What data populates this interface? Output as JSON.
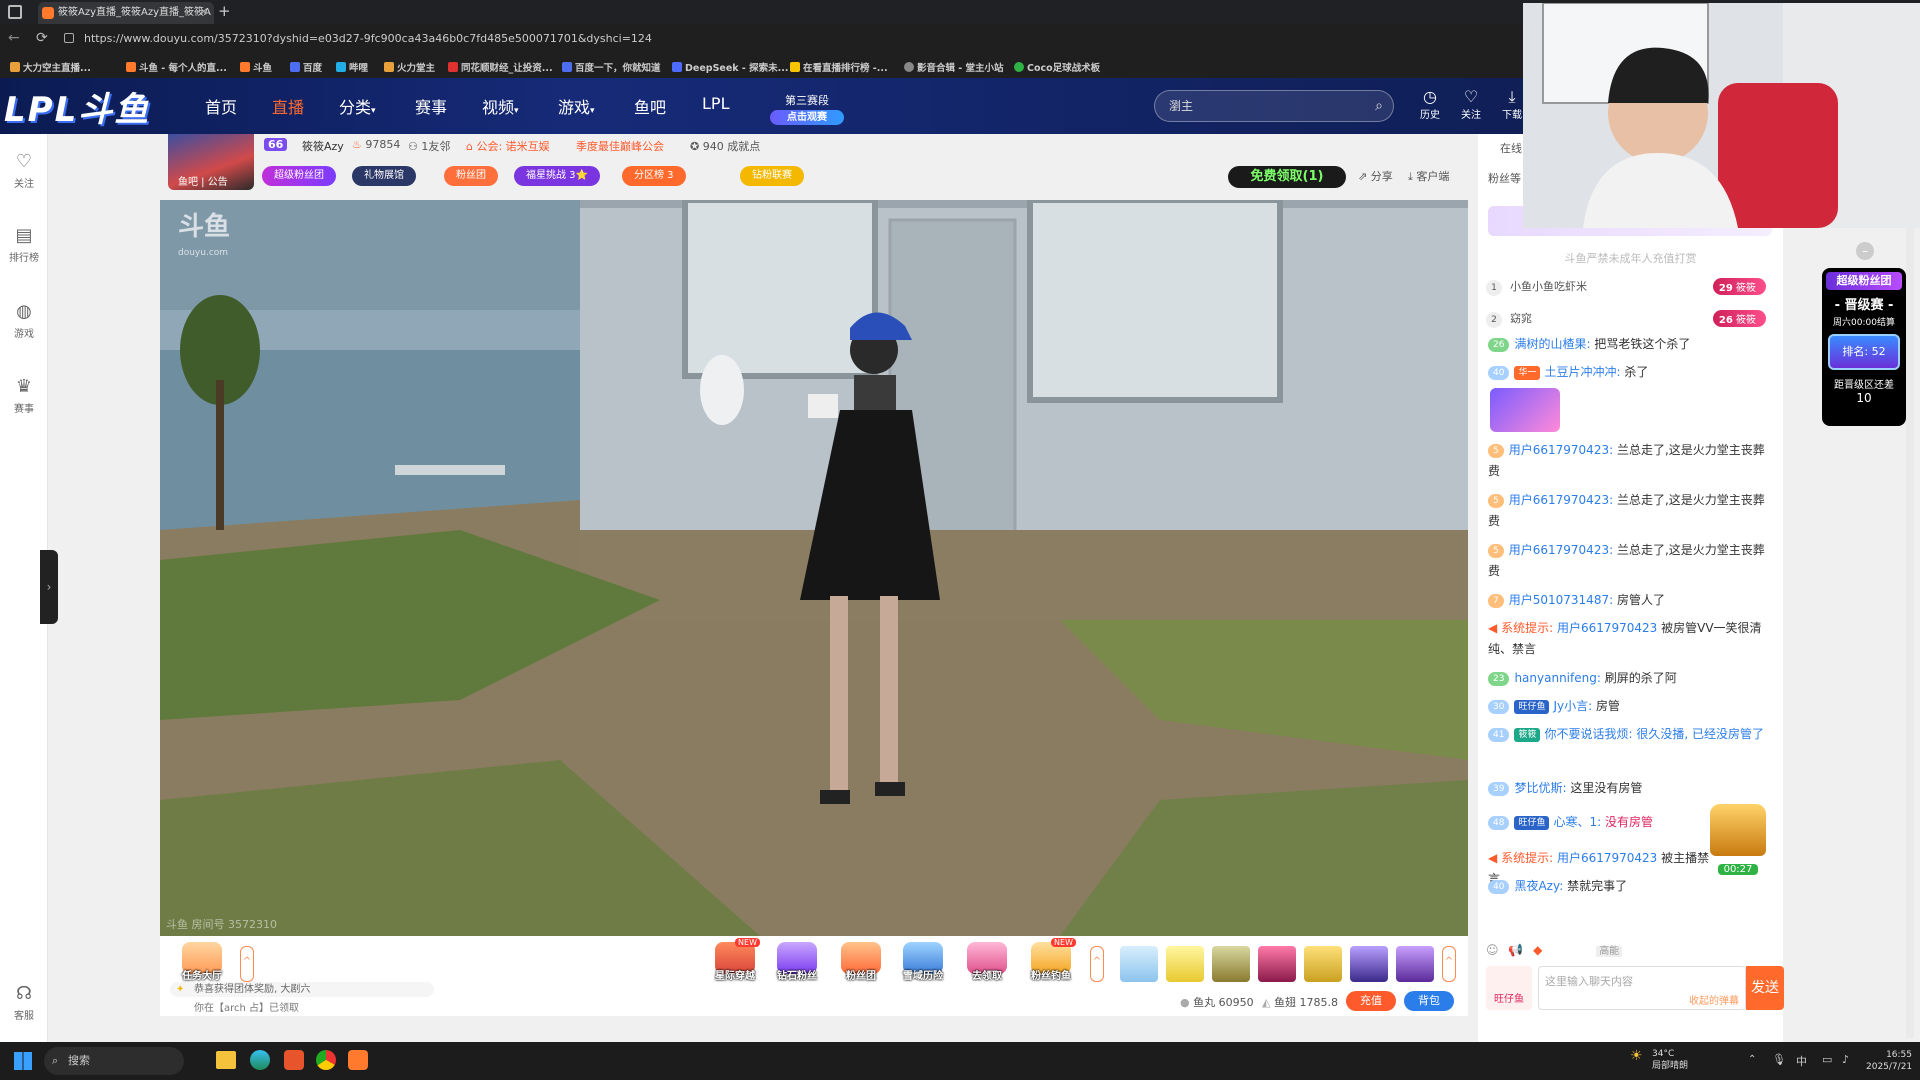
{
  "browser": {
    "tab_title": "筱筱Azy直播_筱筱Azy直播_筱筱A",
    "url": "https://www.douyu.com/3572310?dyshid=e03d27-9fc900ca43a46b0c7fd485e500071701&dyshci=124",
    "bookmarks": [
      "大力空主直播...",
      "斗鱼 - 每个人的直...",
      "斗鱼",
      "百度",
      "哔哩",
      "火力堂主",
      "同花顺财经_让投资...",
      "百度一下，你就知道",
      "DeepSeek - 探索未...",
      "在看直播排行榜 -...",
      "影音合辑 - 堂主小站",
      "Coco足球战术板"
    ]
  },
  "header": {
    "logo": "LPL斗鱼",
    "nav": [
      "首页",
      "直播",
      "分类",
      "赛事",
      "视频",
      "游戏",
      "鱼吧",
      "LPL"
    ],
    "season_line1": "第三赛段",
    "season_line2": "点击观赛",
    "search_placeholder": "瀏主",
    "icons": [
      {
        "label": "历史",
        "icon": "clock-icon"
      },
      {
        "label": "关注",
        "icon": "heart-icon"
      },
      {
        "label": "下载",
        "icon": "download-icon"
      }
    ]
  },
  "sidebar": {
    "items": [
      {
        "label": "关注",
        "icon": "heart-icon"
      },
      {
        "label": "排行榜",
        "icon": "ranking-icon"
      },
      {
        "label": "游戏",
        "icon": "game-icon"
      },
      {
        "label": "赛事",
        "icon": "trophy-icon"
      },
      {
        "label": "客服",
        "icon": "headset-icon"
      }
    ]
  },
  "streamer": {
    "avatar_tags": "鱼吧 | 公告",
    "level": "66",
    "name": "筱筱Azy",
    "hot": "97854",
    "friends": "1友邻",
    "guild": "公会: 诺米互娱",
    "guild_award": "季度最佳巅峰公会",
    "achievement": "940 成就点",
    "badges": [
      "超级粉丝团",
      "礼物展馆",
      "粉丝团",
      "福星挑战 3⭐",
      "分区榜 3",
      "钻粉联赛"
    ],
    "free_btn": "免费领取(1)",
    "share": "分享",
    "client": "客户端"
  },
  "video": {
    "watermark": "斗鱼",
    "watermark_url": "douyu.com",
    "bottom_watermark": "斗鱼 房间号 3572310"
  },
  "giftbar": {
    "task_hall": "任务大厅",
    "gifts": [
      "星际穿越",
      "钻石粉丝",
      "粉丝团",
      "雪域历险",
      "去领取",
      "粉丝钓鱼"
    ],
    "fish_ball": "鱼丸 60950",
    "fish_chip": "鱼翅 1785.8",
    "recharge": "充值",
    "backpack": "背包",
    "ticker1": "恭喜获得团体奖励, 大剧六",
    "ticker2": "你在【arch 占】已领取"
  },
  "chat": {
    "tabs": [
      "在线",
      "粉丝等"
    ],
    "notice": "斗鱼严禁未成年人充值打赏",
    "rank": [
      {
        "num": "1",
        "name": "小鱼小鱼吃虾米",
        "lv": "29",
        "pill": "筱筱"
      },
      {
        "num": "2",
        "name": "窈窕",
        "lv": "26",
        "pill": "筱筱"
      }
    ],
    "messages": [
      {
        "lv": "26",
        "lvc": "g",
        "user": "满树的山楂果:",
        "text": "把骂老铁这个杀了"
      },
      {
        "lv": "40",
        "lvc": "",
        "badge": "华一",
        "user": "土豆片冲冲冲:",
        "text": "杀了"
      },
      {
        "lv": "5",
        "lvc": "o",
        "user": "用户6617970423:",
        "text": "兰总走了,这是火力堂主丧葬费"
      },
      {
        "lv": "5",
        "lvc": "o",
        "user": "用户6617970423:",
        "text": "兰总走了,这是火力堂主丧葬费"
      },
      {
        "lv": "5",
        "lvc": "o",
        "user": "用户6617970423:",
        "text": "兰总走了,这是火力堂主丧葬费"
      },
      {
        "lv": "7",
        "lvc": "o",
        "user": "用户5010731487:",
        "text": "房管人了"
      },
      {
        "sys": "系统提示:",
        "user": "用户6617970423",
        "text": "被房管VV一笑很清纯、禁言"
      },
      {
        "lv": "23",
        "lvc": "g",
        "user": "hanyannifeng:",
        "text": "刷屏的杀了阿"
      },
      {
        "lv": "30",
        "lvc": "",
        "badge": "旺仔鱼",
        "user": "Jy小言:",
        "text": "房管"
      },
      {
        "lv": "41",
        "lvc": "",
        "badge": "筱筱",
        "user": "你不要说话我烦:",
        "text": "很久没播, 已经没房管了"
      },
      {
        "lv": "39",
        "lvc": "",
        "user": "梦比优斯:",
        "text": "这里没有房管"
      },
      {
        "lv": "48",
        "lvc": "",
        "badge": "旺仔鱼",
        "user": "心寒、1:",
        "text": "没有房管"
      },
      {
        "sys": "系统提示:",
        "user": "用户6617970423",
        "text": "被主播禁言"
      },
      {
        "lv": "40",
        "lvc": "",
        "user": "黑夜Azy:",
        "text": "禁就完事了"
      }
    ],
    "chest_timer": "00:27",
    "input_placeholder": "这里输入聊天内容",
    "input_hint": "收起的弹幕",
    "send": "发送",
    "quality": "高能",
    "wangzai": "旺仔鱼"
  },
  "fan_card": {
    "title": "超级粉丝团",
    "subtitle": "- 晋级赛 -",
    "time": "周六00:00结算",
    "rank_label": "排名: 52",
    "gap_label": "距晋级区还差",
    "gap_value": "10"
  },
  "taskbar": {
    "search": "搜索",
    "weather_temp": "34°C",
    "weather_desc": "局部晴朗",
    "ime": "中",
    "time": "16:55",
    "date": "2025/7/21"
  }
}
